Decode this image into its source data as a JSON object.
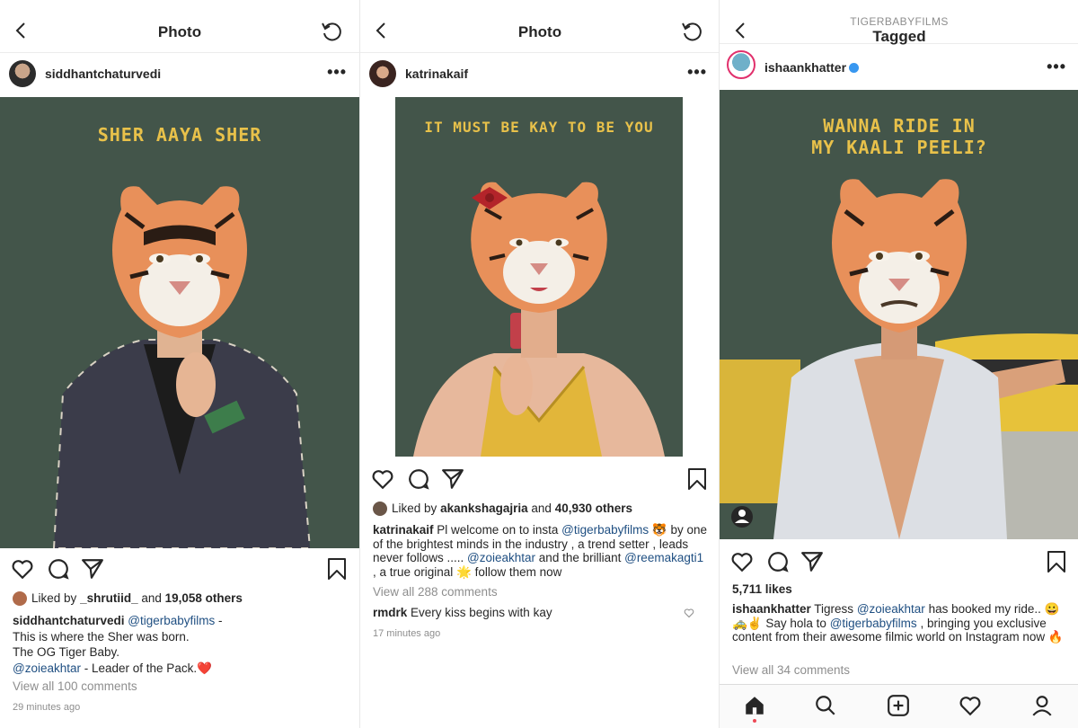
{
  "panel1": {
    "header_title": "Photo",
    "username": "siddhantchaturvedi",
    "more_label": "•••",
    "photo_caption": "SHER AAYA SHER",
    "liked_by_prefix": "Liked by",
    "liked_by_user": "_shrutiid_",
    "liked_by_and": "and",
    "liked_by_others": "19,058 others",
    "caption": {
      "user": "siddhantchaturvedi",
      "mention1": "@tigerbabyfilms",
      "line1_tail": " -",
      "line2": "This is where the Sher was born.",
      "line3": "The OG Tiger Baby.",
      "mention2": "@zoieakhtar",
      "line4_tail": " - Leader of the Pack.",
      "emoji": "❤️"
    },
    "view_comments": "View all 100 comments",
    "timestamp": "29 minutes ago"
  },
  "panel2": {
    "header_title": "Photo",
    "username": "katrinakaif",
    "more_label": "•••",
    "photo_caption": "IT MUST BE KAY TO BE YOU",
    "liked_by_prefix": "Liked by",
    "liked_by_user": "akankshagajria",
    "liked_by_and": "and",
    "liked_by_others": "40,930 others",
    "caption": {
      "user": "katrinakaif",
      "t1": " Pl welcome on to insta ",
      "mention1": "@tigerbabyfilms",
      "emoji1": "🐯",
      "t2": " by one of the brightest minds in the industry , a trend setter , leads never follows ..... ",
      "mention2": "@zoieakhtar",
      "t3": "  and the brilliant ",
      "mention3": "@reemakagti1",
      "t4": " , a true original ",
      "emoji2": "🌟",
      "t5": " follow them now"
    },
    "view_comments": "View all 288 comments",
    "comment_user": "rmdrk",
    "comment_text": " Every kiss begins with kay",
    "timestamp": "17 minutes ago"
  },
  "panel3": {
    "header_subtitle": "TIGERBABYFILMS",
    "header_title": "Tagged",
    "username": "ishaankhatter",
    "more_label": "•••",
    "photo_caption_line1": "WANNA RIDE IN",
    "photo_caption_line2": "MY KAALI PEELI?",
    "likes": "5,711 likes",
    "caption": {
      "user": "ishaankhatter",
      "t1": " Tigress ",
      "mention1": "@zoieakhtar",
      "t2": " has booked my ride..",
      "emoji1": "😀🚕✌️",
      "t3": "  Say hola to ",
      "mention2": "@tigerbabyfilms",
      "t4": " , bringing you exclusive content from their awesome filmic world on Instagram now ",
      "emoji2": "🔥"
    },
    "view_comments": "View all 34 comments"
  },
  "icons": {
    "back": "chevron-left-icon",
    "refresh": "refresh-icon",
    "like": "heart-icon",
    "comment": "comment-icon",
    "share": "send-icon",
    "save": "bookmark-icon",
    "home": "home-icon",
    "search": "search-icon",
    "new_post": "add-post-icon",
    "activity": "heart-icon",
    "profile": "profile-icon"
  },
  "colors": {
    "poster_bg": "#43554a",
    "caption_yellow": "#e8c14a",
    "link": "#1f4f82",
    "verified": "#3897f0"
  }
}
